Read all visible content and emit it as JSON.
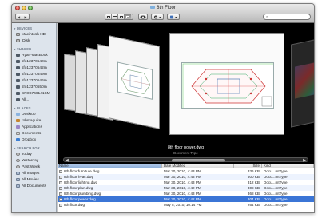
{
  "window": {
    "title": "8th Floor"
  },
  "toolbar": {
    "back": "◀",
    "forward": "▶",
    "search_placeholder": ""
  },
  "sidebar": {
    "sections": [
      {
        "heading": "DEVICES",
        "items": [
          {
            "label": "Macintosh HD",
            "icon": "disk-icon"
          },
          {
            "label": "iDisk",
            "icon": "disk-icon"
          }
        ]
      },
      {
        "heading": "SHARED",
        "items": [
          {
            "label": "Ryan-MacBook",
            "icon": "computer-icon"
          },
          {
            "label": "sfo12370540m",
            "icon": "computer-icon"
          },
          {
            "label": "sfo12370542m",
            "icon": "computer-icon"
          },
          {
            "label": "sfo12370549m",
            "icon": "computer-icon"
          },
          {
            "label": "sfo12370546m",
            "icon": "computer-icon"
          },
          {
            "label": "sfo12370550m",
            "icon": "computer-icon"
          },
          {
            "label": "SFO6766141SM",
            "icon": "computer-icon"
          },
          {
            "label": "All...",
            "icon": "computer-icon"
          }
        ]
      },
      {
        "heading": "PLACES",
        "items": [
          {
            "label": "Desktop",
            "icon": "folder-icon"
          },
          {
            "label": "robmaguire",
            "icon": "home-icon"
          },
          {
            "label": "Applications",
            "icon": "applications-icon"
          },
          {
            "label": "Documents",
            "icon": "documents-icon"
          },
          {
            "label": "Dropbox",
            "icon": "dropbox-icon"
          }
        ]
      },
      {
        "heading": "SEARCH FOR",
        "items": [
          {
            "label": "Today",
            "icon": "clock-icon"
          },
          {
            "label": "Yesterday",
            "icon": "clock-icon"
          },
          {
            "label": "Past Week",
            "icon": "clock-icon"
          },
          {
            "label": "All Images",
            "icon": "search-folder-icon"
          },
          {
            "label": "All Movies",
            "icon": "search-folder-icon"
          },
          {
            "label": "All Documents",
            "icon": "search-folder-icon"
          }
        ]
      }
    ]
  },
  "coverflow": {
    "title": "8th floor power.dwg",
    "subtitle": "Document Type"
  },
  "list": {
    "columns": {
      "name": "Name",
      "date": "Date Modified",
      "size": "Size",
      "kind": "Kind"
    },
    "rows": [
      {
        "name": "8th floor furniture.dwg",
        "date": "Mar 30, 2010, 4:43 PM",
        "size": "336 KB",
        "kind": "Docu...mtType",
        "selected": false
      },
      {
        "name": "8th floor hvac.dwg",
        "date": "Mar 30, 2010, 4:43 PM",
        "size": "500 KB",
        "kind": "Docu...mtType",
        "selected": false
      },
      {
        "name": "8th floor lighting.dwg",
        "date": "Mar 30, 2010, 4:43 PM",
        "size": "312 KB",
        "kind": "Docu...mtType",
        "selected": false
      },
      {
        "name": "8th floor plan.dwg",
        "date": "Mar 30, 2010, 4:42 PM",
        "size": "308 KB",
        "kind": "Docu...mtType",
        "selected": false
      },
      {
        "name": "8th floor plumbing.dwg",
        "date": "Mar 30, 2010, 4:43 PM",
        "size": "368 KB",
        "kind": "Docu...mtType",
        "selected": false
      },
      {
        "name": "8th floor power.dwg",
        "date": "Mar 30, 2010, 4:42 PM",
        "size": "304 KB",
        "kind": "Docu...mtType",
        "selected": true
      },
      {
        "name": "8th floor.dwg",
        "date": "May 5, 2010, 10:14 PM",
        "size": "264 KB",
        "kind": "Docu...mtType",
        "selected": false
      }
    ]
  }
}
